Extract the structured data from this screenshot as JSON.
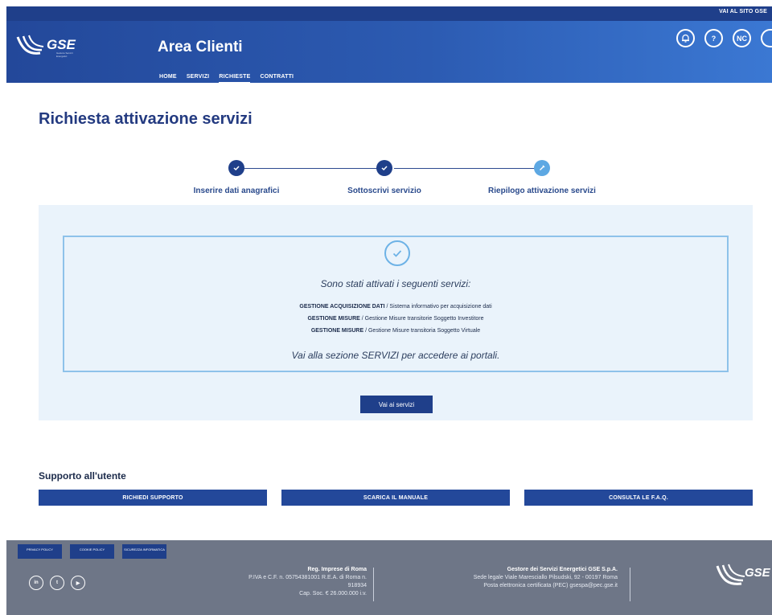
{
  "header": {
    "top_link": "VAI AL SITO GSE",
    "logo_text": "GSE",
    "logo_sub": "Gestore Servizi Energetici",
    "app_title": "Area Clienti",
    "nav": [
      "HOME",
      "SERVIZI",
      "RICHIESTE",
      "CONTRATTI"
    ],
    "icons": [
      {
        "name": "notification-icon",
        "glyph": "⍝"
      },
      {
        "name": "help-icon",
        "glyph": "?"
      },
      {
        "name": "user-initials-icon",
        "glyph": "NC"
      },
      {
        "name": "logout-icon",
        "glyph": ""
      }
    ]
  },
  "page": {
    "title": "Richiesta attivazione servizi"
  },
  "stepper": {
    "steps": [
      {
        "label": "Inserire dati anagrafici",
        "state": "done"
      },
      {
        "label": "Sottoscrivi servizio",
        "state": "done"
      },
      {
        "label": "Riepilogo attivazione servizi",
        "state": "current"
      }
    ]
  },
  "result": {
    "title": "Sono stati attivati i seguenti servizi:",
    "services": [
      {
        "bold": "GESTIONE ACQUISIZIONE DATI",
        "rest": " / Sistema informativo per acquisizione dati"
      },
      {
        "bold": "GESTIONE MISURE",
        "rest": " / Gestione Misure transitorie Soggetto Investitore"
      },
      {
        "bold": "GESTIONE MISURE",
        "rest": " / Gestione Misure transitoria Soggetto Virtuale"
      }
    ],
    "footer_text": "Vai alla sezione SERVIZI per accedere ai portali.",
    "button_label": "Vai ai servizi"
  },
  "support": {
    "title": "Supporto all'utente",
    "buttons": [
      "RICHIEDI SUPPORTO",
      "SCARICA IL MANUALE",
      "CONSULTA LE F.A.Q."
    ]
  },
  "footer": {
    "links": [
      "PRIVACY POLICY",
      "COOKIE POLICY",
      "SICUREZZA INFORMATICA"
    ],
    "social": [
      "in",
      "t",
      "▶"
    ],
    "col1_title": "Reg. Imprese di Roma",
    "col1_lines": [
      "P.IVA e C.F. n. 05754381001 R.E.A. di Roma n.",
      "918934",
      "Cap. Soc. € 26.000.000 i.v."
    ],
    "col2_title": "Gestore dei Servizi Energetici GSE S.p.A.",
    "col2_lines": [
      "Sede legale Viale Maresciallo Pilsudski, 92 - 00197 Roma",
      "Posta elettronica certificata (PEC) gsespa@pec.gse.it"
    ],
    "logo_text": "GSE"
  },
  "colors": {
    "header_dark": "#1f3f8a",
    "accent": "#23489a",
    "panel_bg": "#eaf3fb",
    "box_border": "#8ec2ea",
    "step_current": "#5da8e3",
    "footer_bg": "#6e7687"
  }
}
